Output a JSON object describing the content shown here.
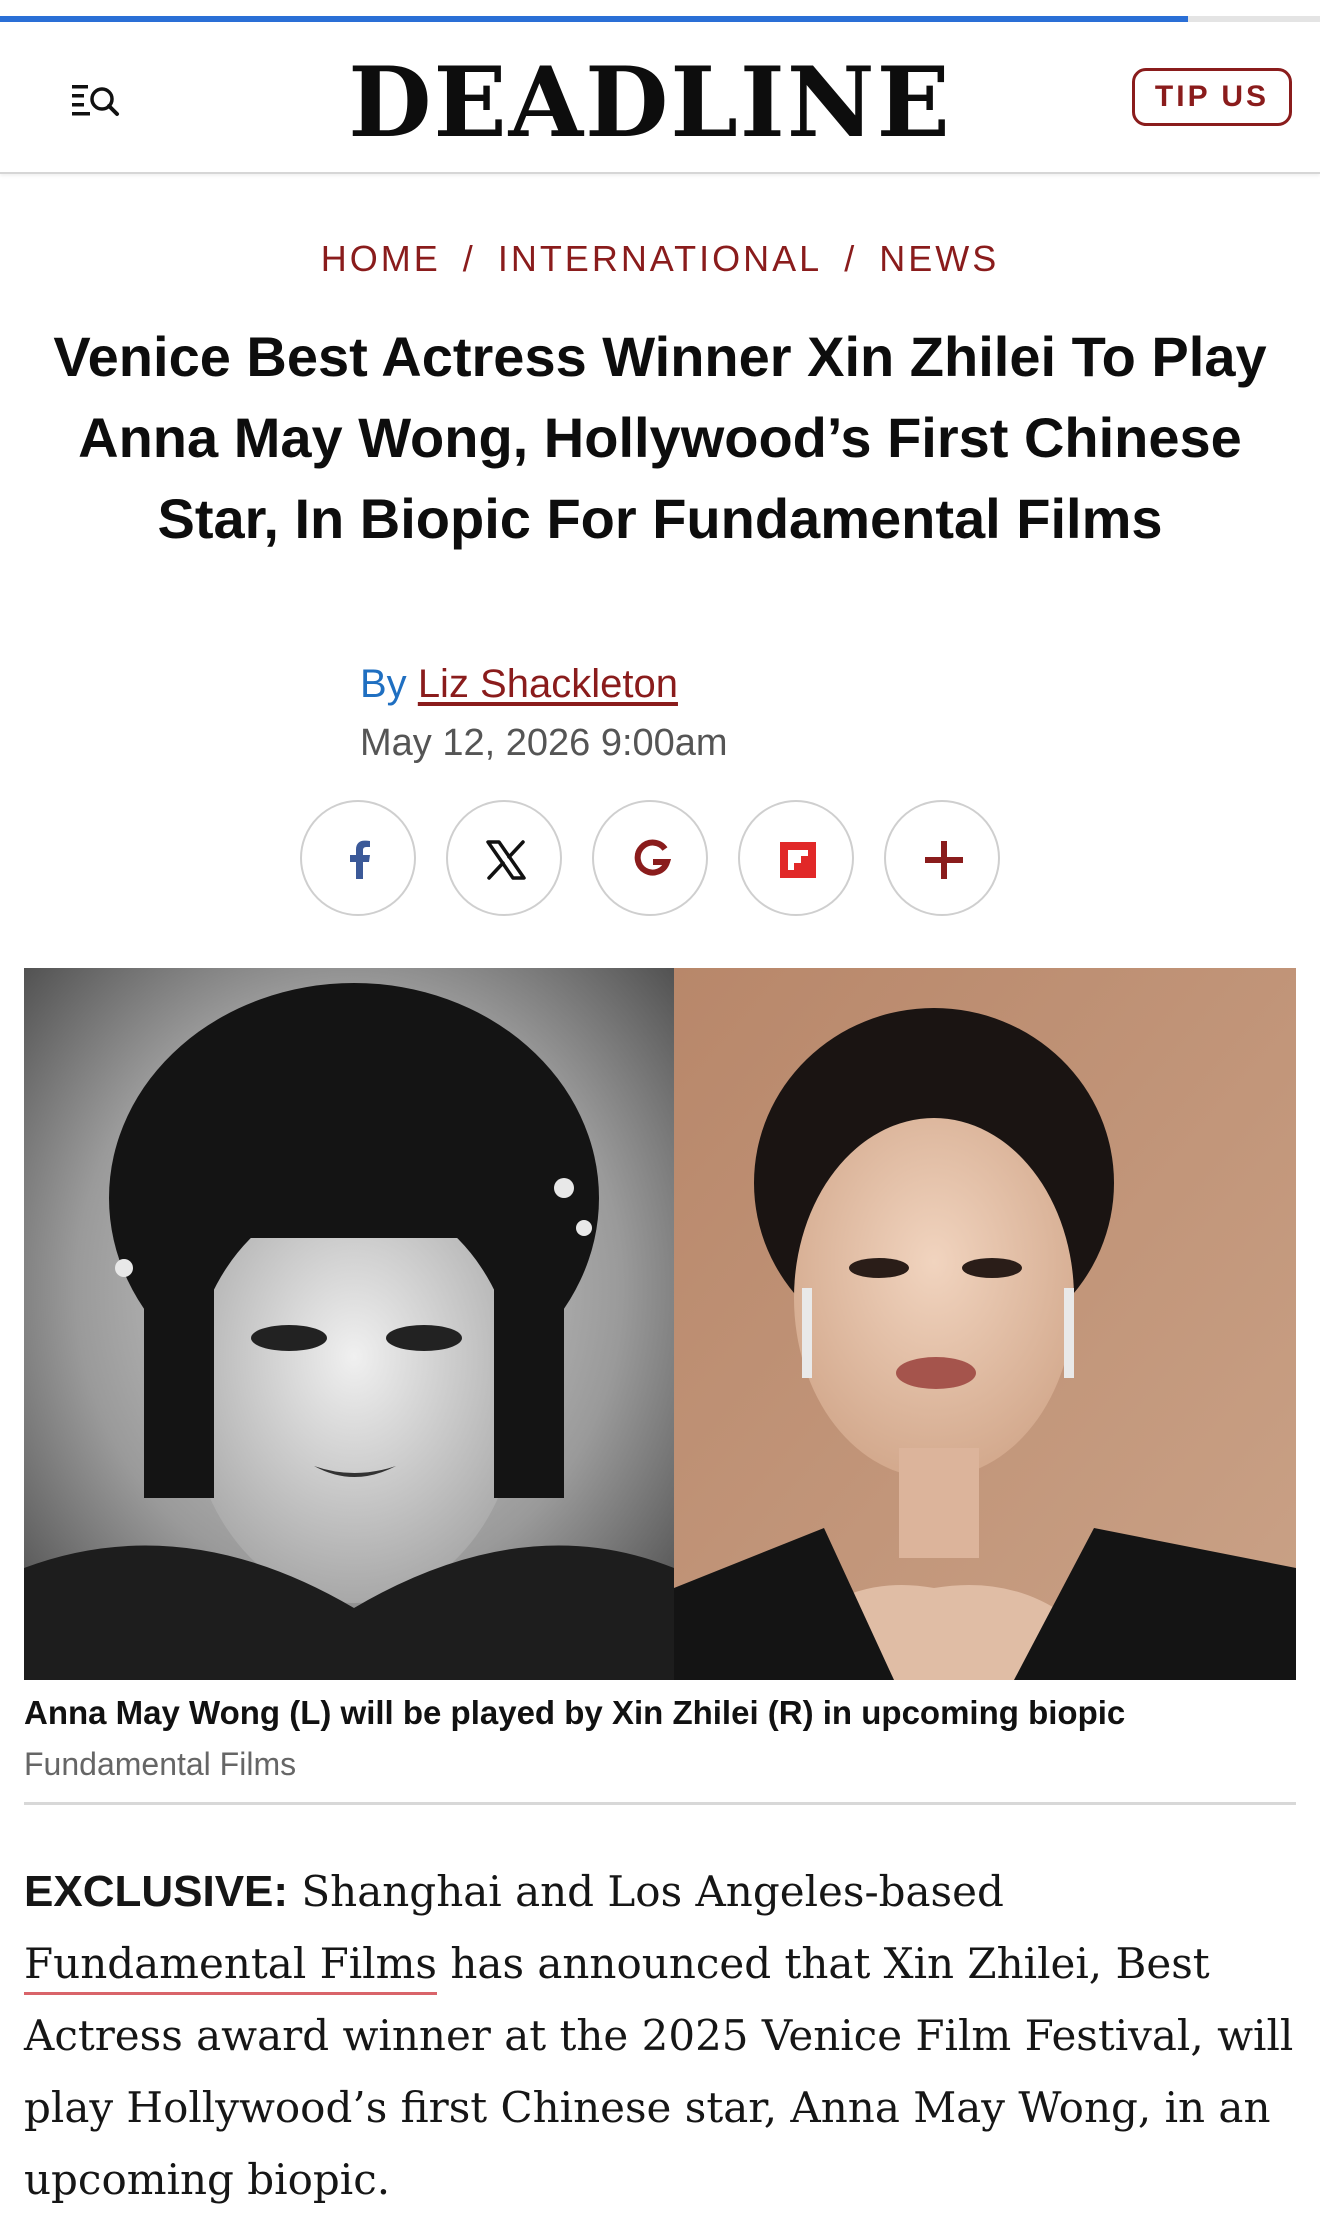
{
  "reading_progress": 0.9,
  "header": {
    "logo": "DEADLINE",
    "tip_button": "TIP US",
    "menu_icon": "menu-search-icon"
  },
  "breadcrumb": {
    "items": [
      "HOME",
      "INTERNATIONAL",
      "NEWS"
    ],
    "separator": "/"
  },
  "article": {
    "headline": "Venice Best Actress Winner Xin Zhilei To Play Anna May Wong, Hollywood’s First Chinese Star, In Biopic For Fundamental Films",
    "byline_prefix": "By",
    "author": "Liz Shackleton",
    "date": "May 12, 2026 9:00am",
    "caption": "Anna May Wong (L) will be played by Xin Zhilei (R) in upcoming biopic",
    "credit": "Fundamental Films",
    "body": {
      "lead": "EXCLUSIVE:",
      "text_1": " Shanghai and Los Angeles-based ",
      "link": "Fundamental Films",
      "text_2": " has announced that Xin Zhilei, Best Actress award winner at the 2025 Venice Film Festival, will play Hollywood’s first Chinese star, Anna May Wong, in an upcoming biopic."
    }
  },
  "share": {
    "buttons": [
      "facebook-icon",
      "x-icon",
      "google-icon",
      "flipboard-icon",
      "plus-icon"
    ]
  },
  "colors": {
    "brand_red": "#8a1c1c",
    "progress_blue": "#2a6fd6",
    "byline_blue": "#1f6fc1",
    "facebook_blue": "#3b5998",
    "link_underline": "#d9646a"
  }
}
